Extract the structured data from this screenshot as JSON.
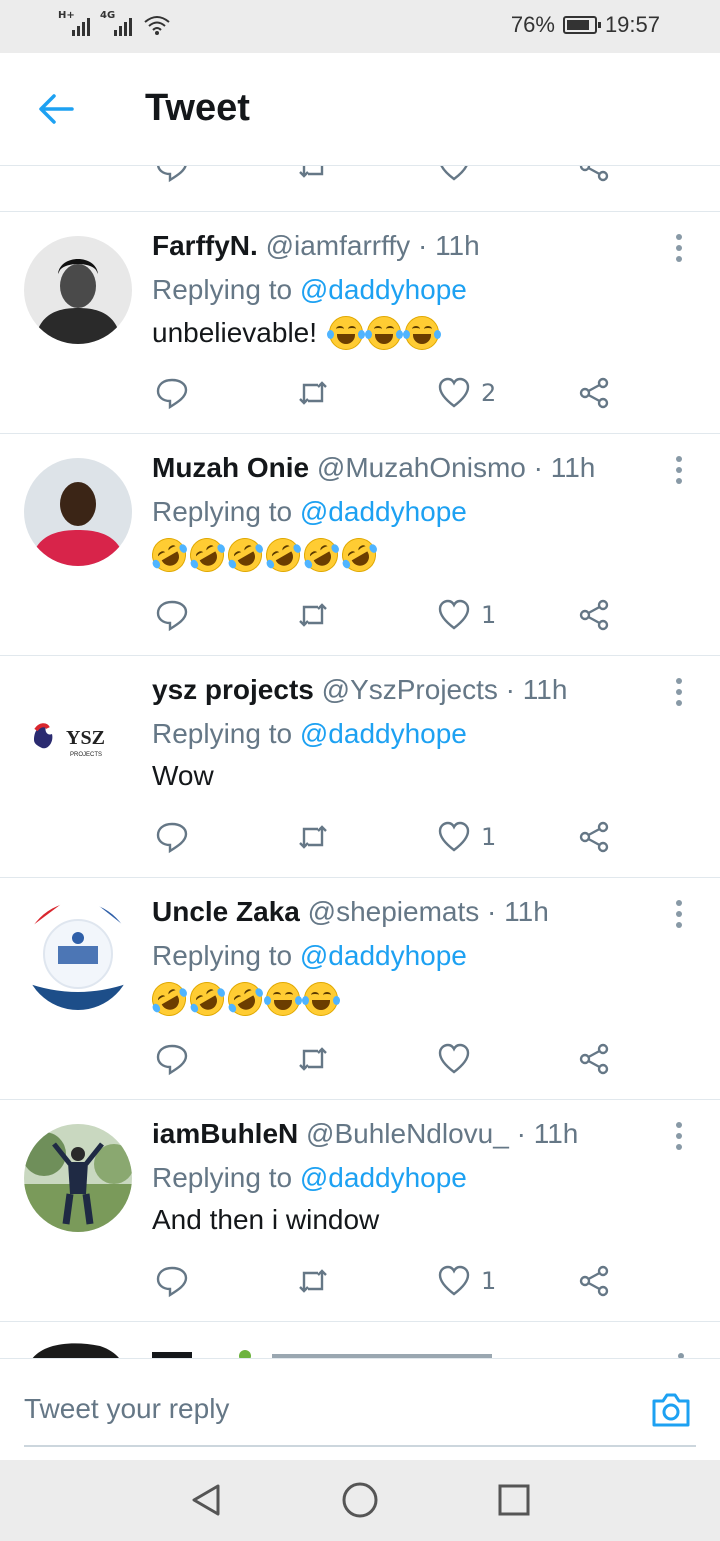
{
  "status_bar": {
    "network1": "H+",
    "network2": "4G",
    "battery_percent": "76%",
    "time": "19:57"
  },
  "header": {
    "title": "Tweet",
    "back_icon": "arrow-left-icon"
  },
  "tweets": [
    {
      "name": "FarffyN.",
      "handle": "@iamfarrffy",
      "dot": "·",
      "time": "11h",
      "replying_label": "Replying to",
      "replying_to": "@daddyhope",
      "text": "unbelievable!",
      "emojis": [
        "face-with-tears-of-joy",
        "face-with-tears-of-joy",
        "face-with-tears-of-joy"
      ],
      "likes": "2"
    },
    {
      "name": "Muzah Onie",
      "handle": "@MuzahOnismo",
      "dot": "·",
      "time": "11h",
      "replying_label": "Replying to",
      "replying_to": "@daddyhope",
      "text": "",
      "emojis": [
        "rolling-on-floor-laughing",
        "rolling-on-floor-laughing",
        "rolling-on-floor-laughing",
        "rolling-on-floor-laughing",
        "rolling-on-floor-laughing",
        "rolling-on-floor-laughing"
      ],
      "likes": "1"
    },
    {
      "name": "ysz projects",
      "handle": "@YszProjects",
      "dot": "·",
      "time": "11h",
      "replying_label": "Replying to",
      "replying_to": "@daddyhope",
      "text": "Wow",
      "emojis": [],
      "likes": "1",
      "avatar_logo_text": "YSZ",
      "avatar_logo_sub": "PROJECTS"
    },
    {
      "name": "Uncle Zaka",
      "handle": "@shepiemats",
      "dot": "·",
      "time": "11h",
      "replying_label": "Replying to",
      "replying_to": "@daddyhope",
      "text": "",
      "emojis": [
        "rolling-on-floor-laughing",
        "rolling-on-floor-laughing",
        "rolling-on-floor-laughing",
        "face-with-tears-of-joy",
        "face-with-tears-of-joy"
      ],
      "likes": ""
    },
    {
      "name": "iamBuhleN",
      "handle": "@BuhleNdlovu_",
      "dot": "·",
      "time": "11h",
      "replying_label": "Replying to",
      "replying_to": "@daddyhope",
      "text": "And then i window",
      "emojis": [],
      "likes": "1"
    }
  ],
  "reply_box": {
    "placeholder": "Tweet your reply",
    "camera_icon": "camera-icon"
  },
  "colors": {
    "accent": "#1da1f2",
    "secondary_text": "#657786",
    "divider": "#e1e8ed"
  }
}
